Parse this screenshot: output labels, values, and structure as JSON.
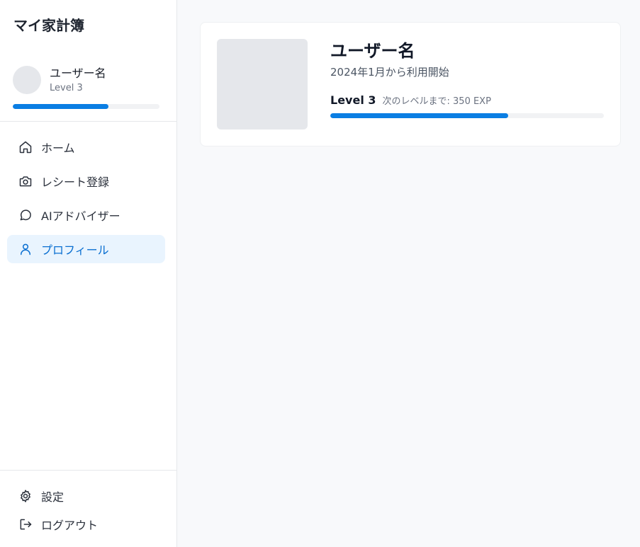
{
  "app": {
    "title": "マイ家計簿"
  },
  "sidebar": {
    "user": {
      "name": "ユーザー名",
      "level": "Level 3",
      "progress": 0.65
    },
    "nav": [
      {
        "label": "ホーム",
        "icon": "home-icon",
        "active": false
      },
      {
        "label": "レシート登録",
        "icon": "camera-icon",
        "active": false
      },
      {
        "label": "AIアドバイザー",
        "icon": "chat-bubble-icon",
        "active": false
      },
      {
        "label": "プロフィール",
        "icon": "user-icon",
        "active": true
      }
    ],
    "bottom": [
      {
        "label": "設定",
        "icon": "gear-icon"
      },
      {
        "label": "ログアウト",
        "icon": "logout-icon"
      }
    ]
  },
  "profile": {
    "name": "ユーザー名",
    "since": "2024年1月から利用開始",
    "level": "Level 3",
    "next_level": "次のレベルまで: 350 EXP",
    "progress": 0.65
  },
  "colors": {
    "accent": "#0a7ee3",
    "active_bg": "#e9f4fe",
    "active_text": "#0a6fd1",
    "placeholder": "#e5e7eb"
  }
}
